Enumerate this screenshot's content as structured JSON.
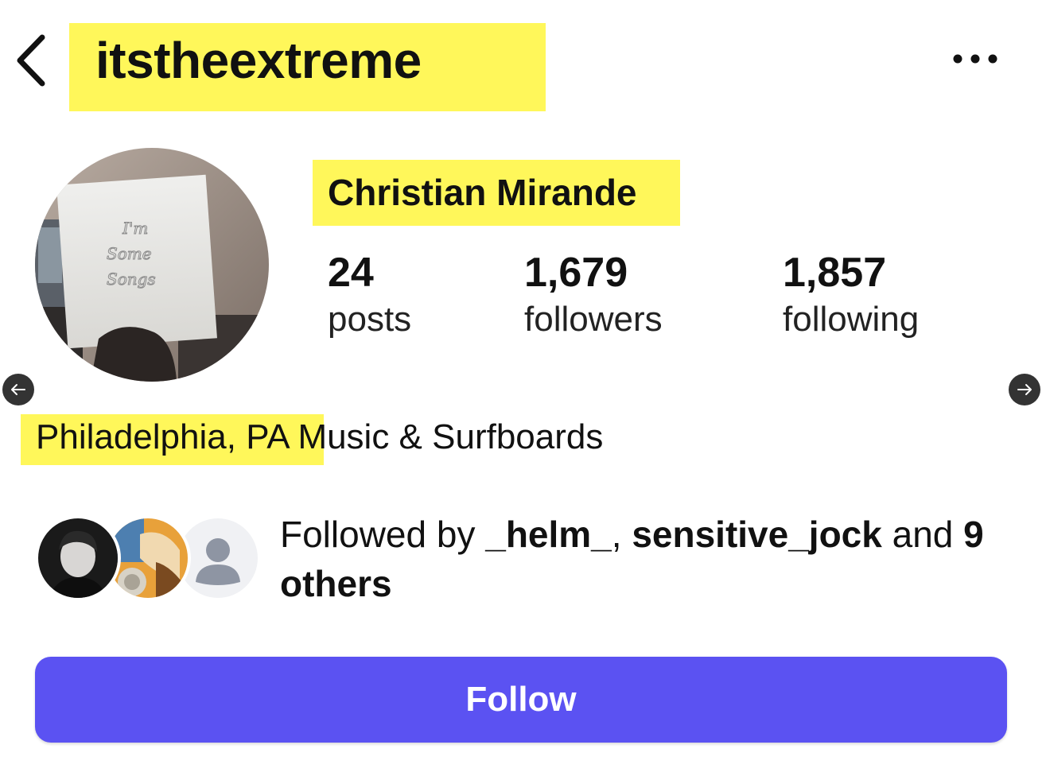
{
  "header": {
    "username": "itstheextreme",
    "back_icon": "chevron-left-icon",
    "more_icon": "more-horizontal-icon"
  },
  "profile": {
    "full_name": "Christian Mirande",
    "avatar_text": [
      "I'm",
      "Some",
      "Songs"
    ],
    "stats": [
      {
        "value": "24",
        "label": "posts"
      },
      {
        "value": "1,679",
        "label": "followers"
      },
      {
        "value": "1,857",
        "label": "following"
      }
    ],
    "location": "Philadelphia, PA",
    "bio": "Music & Surfboards"
  },
  "followed_by": {
    "prefix": "Followed by",
    "user1": "_helm_",
    "separator": ",",
    "user2": "sensitive_jock",
    "connector": "and",
    "others": "9 others"
  },
  "actions": {
    "follow_label": "Follow"
  },
  "colors": {
    "highlight": "#fff75a",
    "follow_button": "#5b52f2",
    "arrow_bg": "#333333"
  }
}
